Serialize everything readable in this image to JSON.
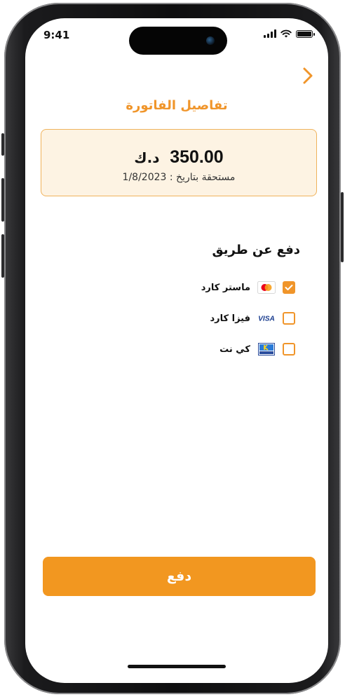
{
  "status_bar": {
    "time": "9:41"
  },
  "header": {
    "title": "تفاصيل الفاتورة"
  },
  "invoice": {
    "amount": "350.00",
    "currency": "د.ك",
    "due_date_text": "مستحقة بتاريخ : 1/8/2023"
  },
  "payment": {
    "heading": "دفع عن طريق",
    "options": [
      {
        "label": "ماستر كارد",
        "icon": "mastercard-icon",
        "checked": true
      },
      {
        "label": "فيزا كارد",
        "icon": "visa-icon",
        "checked": false
      },
      {
        "label": "كي نت",
        "icon": "knet-icon",
        "checked": false
      }
    ]
  },
  "actions": {
    "pay_label": "دفع"
  },
  "colors": {
    "accent": "#f29720",
    "card_bg": "#fdf3e3",
    "card_border": "#f0b35c"
  }
}
